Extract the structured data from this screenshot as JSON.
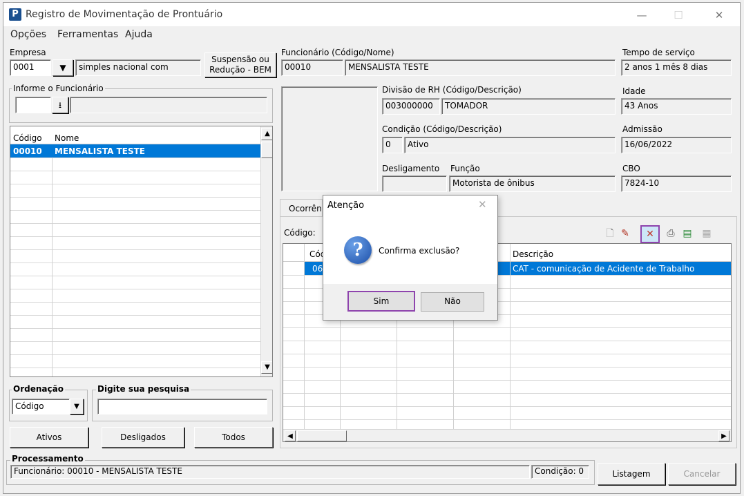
{
  "window": {
    "title": "Registro de Movimentação de Prontuário",
    "minimize": "—",
    "maximize": "☐",
    "close": "✕"
  },
  "menu": [
    "Opções",
    "Ferramentas",
    "Ajuda"
  ],
  "empresa": {
    "label": "Empresa",
    "code": "0001",
    "name": "simples nacional com"
  },
  "suspensao_button": {
    "line1": "Suspensão ou",
    "line2": "Redução - BEM"
  },
  "funcionario": {
    "label": "Funcionário (Código/Nome)",
    "code": "00010",
    "name": "MENSALISTA TESTE"
  },
  "tempo_servico": {
    "label": "Tempo de serviço",
    "value": "2 anos 1 mês 8 dias"
  },
  "informe": {
    "label": "Informe o Funcionário"
  },
  "divisao": {
    "label": "Divisão de RH (Código/Descrição)",
    "code": "003000000",
    "desc": "TOMADOR"
  },
  "idade": {
    "label": "Idade",
    "value": "43 Anos"
  },
  "condicao": {
    "label": "Condição (Código/Descrição)",
    "code": "0",
    "desc": "Ativo"
  },
  "admissao": {
    "label": "Admissão",
    "value": "16/06/2022"
  },
  "desligamento": {
    "label": "Desligamento"
  },
  "funcao": {
    "label": "Função",
    "value": "Motorista de ônibus"
  },
  "cbo": {
    "label": "CBO",
    "value": "7824-10"
  },
  "employee_list": {
    "headers": [
      "Código",
      "Nome"
    ],
    "rows": [
      {
        "code": "00010",
        "name": "MENSALISTA TESTE"
      }
    ]
  },
  "ordenacao": {
    "label": "Ordenação",
    "value": "Código"
  },
  "pesquisa": {
    "label": "Digite sua pesquisa",
    "value": ""
  },
  "filters": {
    "ativos": "Ativos",
    "desligados": "Desligados",
    "todos": "Todos"
  },
  "tab": {
    "label": "Ocorrên"
  },
  "codigo_label": "Código:",
  "occurrence_grid": {
    "headers": [
      "Cód",
      "",
      "",
      "Descrição"
    ],
    "rows": [
      {
        "code": "06",
        "desc": "CAT - comunicação de Acidente de Trabalho"
      }
    ]
  },
  "processamento": {
    "label": "Processamento",
    "status": "Funcionário: 00010 - MENSALISTA TESTE",
    "condicao": "Condição: 0"
  },
  "bottom_buttons": {
    "listagem": "Listagem",
    "cancelar": "Cancelar"
  },
  "dialog": {
    "title": "Atenção",
    "message": "Confirma exclusão?",
    "yes": "Sim",
    "no": "Não",
    "icon": "?"
  },
  "colors": {
    "selection": "#0078d7",
    "highlight_border": "#8e44ad"
  }
}
